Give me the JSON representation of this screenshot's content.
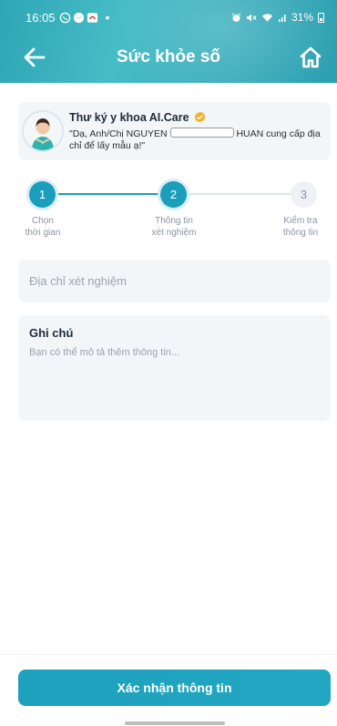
{
  "status_bar": {
    "time": "16:05",
    "battery": "31%",
    "notification_icons": [
      "whatsapp-icon",
      "messenger-icon",
      "app-icon"
    ]
  },
  "nav": {
    "title": "Sức khỏe số",
    "back_icon": "arrow-left-icon",
    "home_icon": "home-icon"
  },
  "assistant": {
    "name": "Thư ký y khoa AI.Care",
    "message_prefix": "\"Dạ, Anh/Chị NGUYEN",
    "message_suffix": "HUAN cung cấp địa chỉ để lấy mẫu ạ!\""
  },
  "steps": [
    {
      "number": "1",
      "label_line1": "Chọn",
      "label_line2": "thời gian",
      "state": "done"
    },
    {
      "number": "2",
      "label_line1": "Thông tin",
      "label_line2": "xét nghiệm",
      "state": "active"
    },
    {
      "number": "3",
      "label_line1": "Kiểm tra",
      "label_line2": "thông tin",
      "state": "pending"
    }
  ],
  "address": {
    "placeholder": "Địa chỉ xét nghiệm",
    "value": ""
  },
  "note": {
    "title": "Ghi chú",
    "placeholder": "Bạn có thể mô tả thêm thông tin...",
    "value": ""
  },
  "footer": {
    "confirm_label": "Xác nhận thông tin"
  },
  "colors": {
    "primary": "#1b9ebb",
    "header": "#3aaebc",
    "field_bg": "#f3f6f9"
  }
}
